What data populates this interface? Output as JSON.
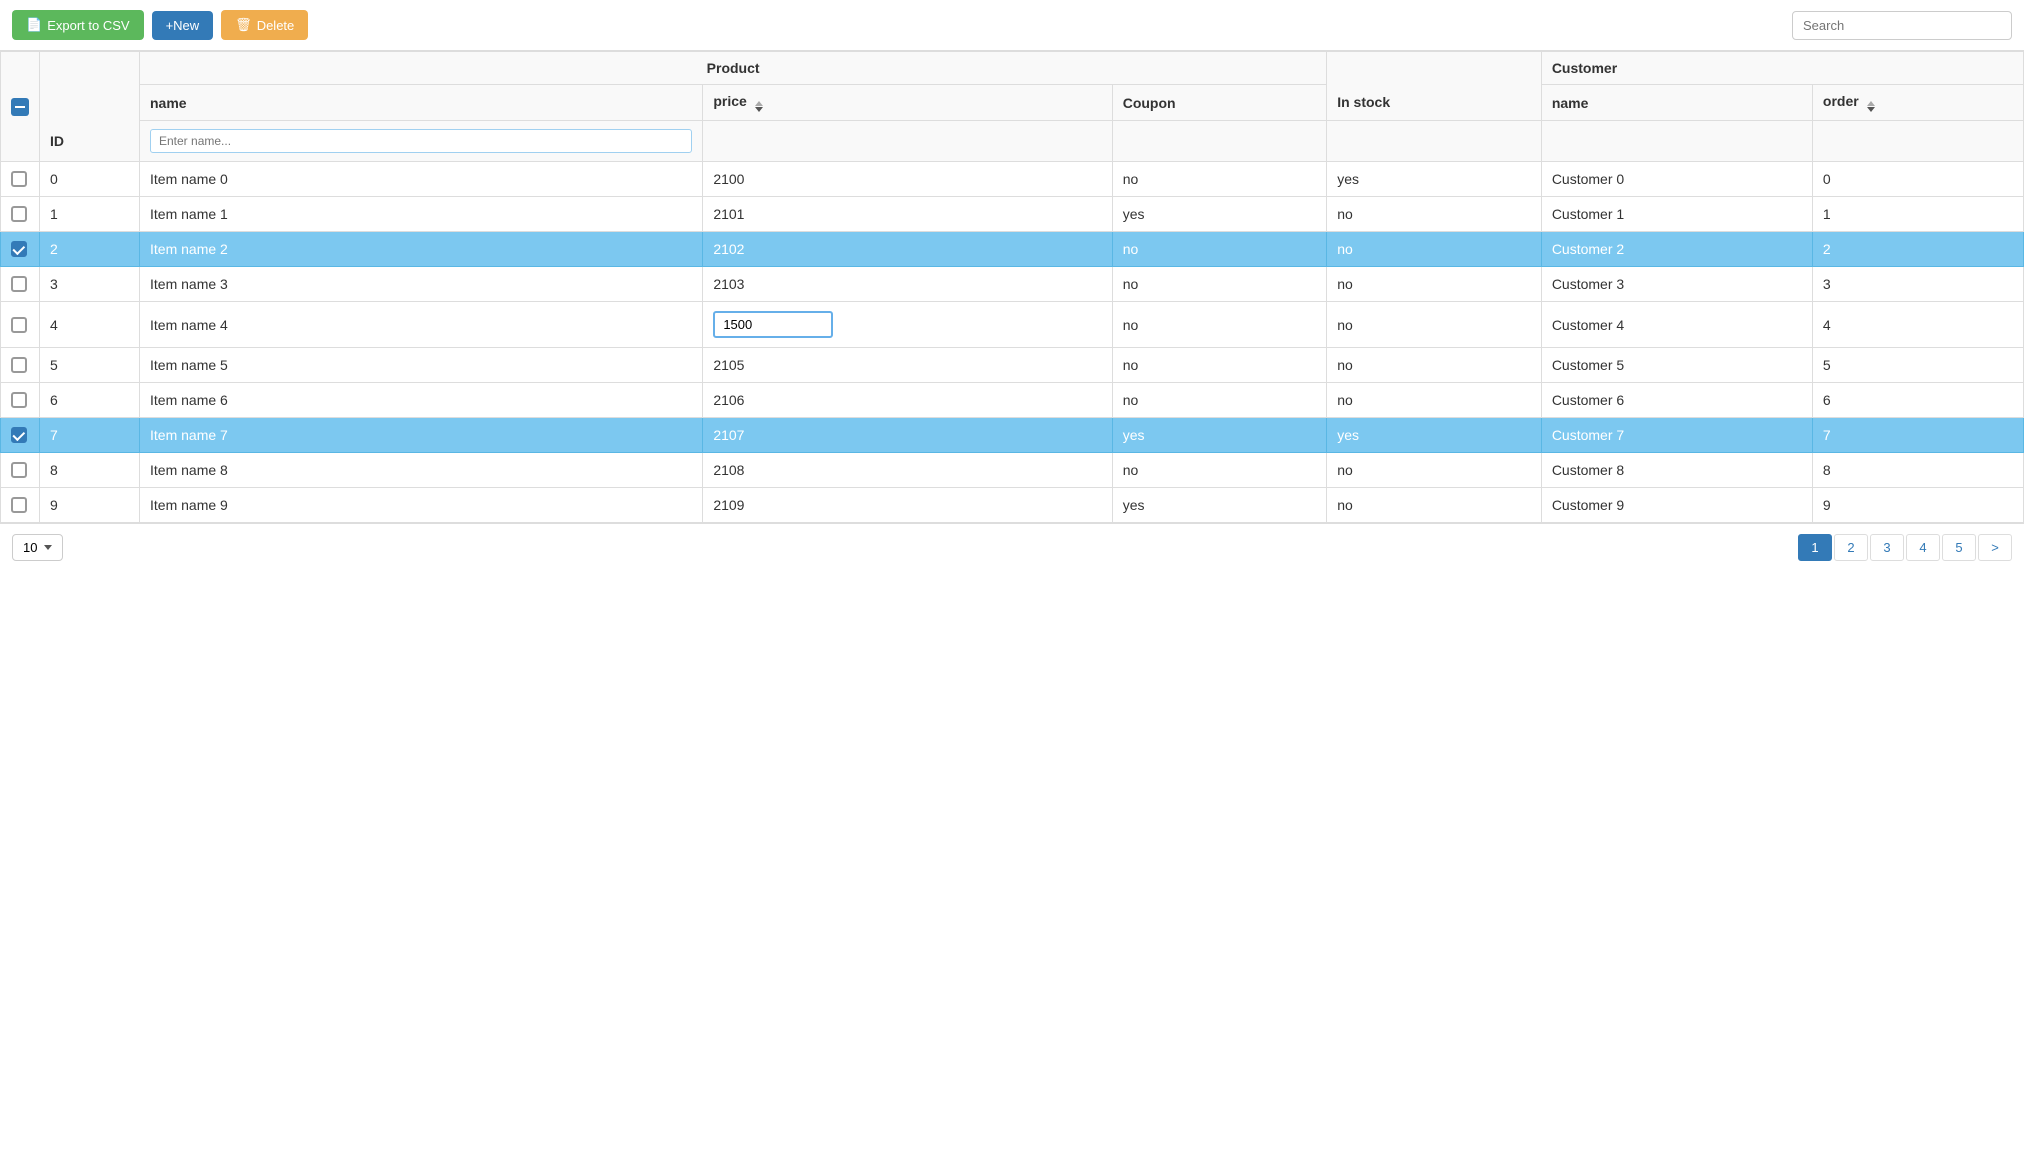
{
  "toolbar": {
    "export_label": "Export to CSV",
    "new_label": "+New",
    "delete_label": "Delete",
    "search_placeholder": "Search"
  },
  "table": {
    "header_group_product": "Product",
    "header_group_customer": "Customer",
    "col_id": "ID",
    "col_product_name": "name",
    "col_product_name_placeholder": "Enter name...",
    "col_price": "price",
    "col_coupon": "Coupon",
    "col_instock": "In stock",
    "col_customer_name": "name",
    "col_order": "order",
    "rows": [
      {
        "id": 0,
        "name": "Item name 0",
        "price": "2100",
        "coupon": "no",
        "instock": "yes",
        "customer": "Customer 0",
        "order": "0",
        "selected": false,
        "price_editing": false
      },
      {
        "id": 1,
        "name": "Item name 1",
        "price": "2101",
        "coupon": "yes",
        "instock": "no",
        "customer": "Customer 1",
        "order": "1",
        "selected": false,
        "price_editing": false
      },
      {
        "id": 2,
        "name": "Item name 2",
        "price": "2102",
        "coupon": "no",
        "instock": "no",
        "customer": "Customer 2",
        "order": "2",
        "selected": true,
        "price_editing": false
      },
      {
        "id": 3,
        "name": "Item name 3",
        "price": "2103",
        "coupon": "no",
        "instock": "no",
        "customer": "Customer 3",
        "order": "3",
        "selected": false,
        "price_editing": false
      },
      {
        "id": 4,
        "name": "Item name 4",
        "price": "1500",
        "coupon": "no",
        "instock": "no",
        "customer": "Customer 4",
        "order": "4",
        "selected": false,
        "price_editing": true
      },
      {
        "id": 5,
        "name": "Item name 5",
        "price": "2105",
        "coupon": "no",
        "instock": "no",
        "customer": "Customer 5",
        "order": "5",
        "selected": false,
        "price_editing": false
      },
      {
        "id": 6,
        "name": "Item name 6",
        "price": "2106",
        "coupon": "no",
        "instock": "no",
        "customer": "Customer 6",
        "order": "6",
        "selected": false,
        "price_editing": false
      },
      {
        "id": 7,
        "name": "Item name 7",
        "price": "2107",
        "coupon": "yes",
        "instock": "yes",
        "customer": "Customer 7",
        "order": "7",
        "selected": true,
        "price_editing": false
      },
      {
        "id": 8,
        "name": "Item name 8",
        "price": "2108",
        "coupon": "no",
        "instock": "no",
        "customer": "Customer 8",
        "order": "8",
        "selected": false,
        "price_editing": false
      },
      {
        "id": 9,
        "name": "Item name 9",
        "price": "2109",
        "coupon": "yes",
        "instock": "no",
        "customer": "Customer 9",
        "order": "9",
        "selected": false,
        "price_editing": false
      }
    ]
  },
  "footer": {
    "page_size": "10",
    "pages": [
      "1",
      "2",
      "3",
      "4",
      "5",
      ">"
    ],
    "active_page": "1"
  }
}
